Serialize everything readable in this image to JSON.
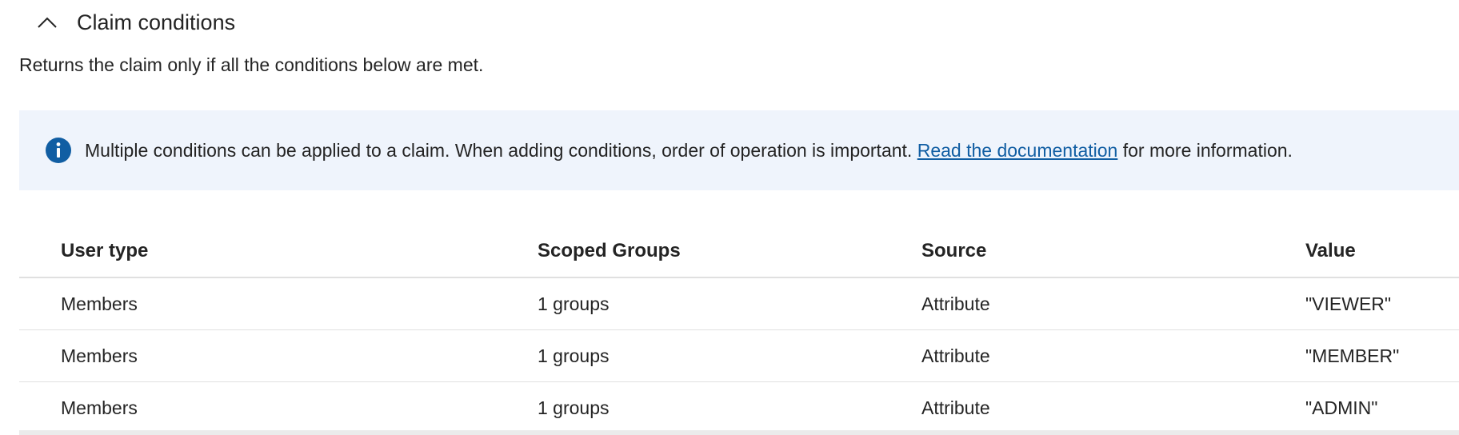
{
  "section": {
    "title": "Claim conditions",
    "description": "Returns the claim only if all the conditions below are met."
  },
  "info": {
    "icon": "info-icon",
    "text": "Multiple conditions can be applied to a claim.  When adding conditions, order of operation is important. ",
    "link_text": "Read the documentation",
    "suffix": " for more information.",
    "color": "#115ea3",
    "background": "#eff4fc"
  },
  "table": {
    "columns": [
      "User type",
      "Scoped Groups",
      "Source",
      "Value"
    ],
    "rows": [
      {
        "user_type": "Members",
        "scoped_groups": "1 groups",
        "source": "Attribute",
        "value": "\"VIEWER\""
      },
      {
        "user_type": "Members",
        "scoped_groups": "1 groups",
        "source": "Attribute",
        "value": "\"MEMBER\""
      },
      {
        "user_type": "Members",
        "scoped_groups": "1 groups",
        "source": "Attribute",
        "value": "\"ADMIN\""
      }
    ]
  }
}
